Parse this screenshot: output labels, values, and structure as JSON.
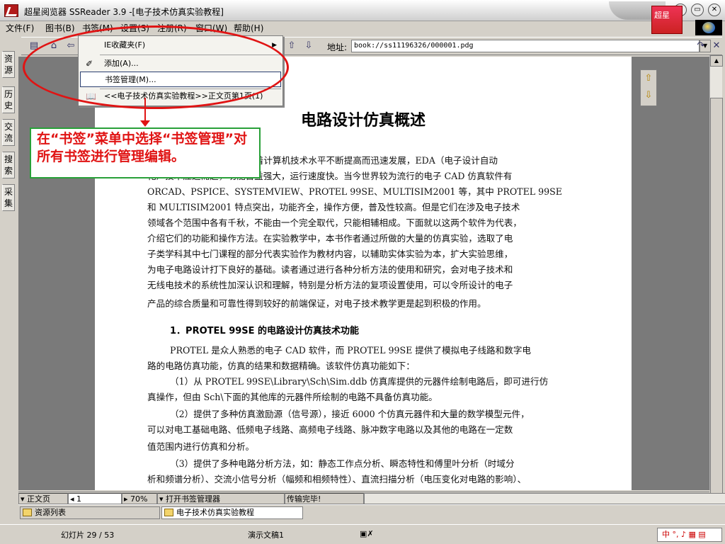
{
  "window": {
    "title": "超星阅览器 SSReader 3.9 -[电子技术仿真实验教程]",
    "brand_label": "超星"
  },
  "menubar": {
    "items": [
      "文件(F)",
      "图书(B)",
      "书签(M)",
      "设置(S)",
      "注册(R)",
      "窗口(W)",
      "帮助(H)"
    ]
  },
  "toolbar": {
    "address_label": "地址:",
    "address_value": "book://ss11196326/000001.pdg"
  },
  "left_tabs": [
    "资源",
    "历史",
    "交流",
    "搜索",
    "采集"
  ],
  "bookmark_menu": {
    "items": [
      {
        "label": "IE收藏夹(F)",
        "has_submenu": true
      },
      {
        "label": "添加(A)..."
      },
      {
        "label": "书签管理(M)...",
        "highlighted": true
      },
      {
        "label": "<<电子技术仿真实验教程>>正文页第1页(1)"
      }
    ]
  },
  "annotation": {
    "text": "在“书签”菜单中选择“书签管理”对所有书签进行管理编辑。"
  },
  "document": {
    "title": "电路设计仿真概述",
    "para1_lines": [
      "软件随着计算机技术水平不断提高而迅速发展，EDA（电子设计自动",
      "化）技术应运而起，功能日益强大，运行速度快。当今世界较为流行的电子 CAD 仿真软件有",
      "ORCAD、PSPICE、SYSTEMVIEW、PROTEL 99SE、MULTISIM2001 等，其中 PROTEL 99SE",
      "和 MULTISIM2001 特点突出，功能齐全，操作方便，普及性较高。但是它们在涉及电子技术",
      "领域各个范围中各有千秋，不能由一个完全取代，只能相辅相成。下面就以这两个软件为代表，",
      "介绍它们的功能和操作方法。在实验教学中，本书作者通过所做的大量的仿真实验，选取了电",
      "子类学科其中七门课程的部分代表实验作为教材内容，以辅助实体实验为本，扩大实验思维，",
      "为电子电路设计打下良好的基础。读者通过进行各种分析方法的使用和研究，会对电子技术和",
      "无线电技术的系统性加深认识和理解，特别是分析方法的复项设置使用，可以令所设计的电子",
      "产品的综合质量和可靠性得到较好的前端保证，对电子技术教学更是起到积极的作用。"
    ],
    "section_heading": "1．PROTEL 99SE 的电路设计仿真技术功能",
    "para2_lines": [
      "PROTEL 是众人熟悉的电子 CAD 软件，而 PROTEL 99SE 提供了模拟电子线路和数字电",
      "路的电路仿真功能，仿真的结果和数据精确。该软件仿真功能如下：",
      "（1）从 PROTEL 99SE\\Library\\Sch\\Sim.ddb 仿真库提供的元器件绘制电路后，即可进行仿",
      "真操作，但由 Sch\\下面的其他库的元器件所绘制的电路不具备仿真功能。",
      "（2）提供了多种仿真激励源（信号源），接近 6000 个仿真元器件和大量的数学模型元件，",
      "可以对电工基础电路、低频电子线路、高频电子线路、脉冲数字电路以及其他的电路在一定数",
      "值范围内进行仿真和分析。",
      "（3）提供了多种电路分析方法，如：静态工作点分析、瞬态特性和傅里叶分析（时域分",
      "析和频谱分析）、交流小信号分析（幅频和相频特性）、直流扫描分析（电压变化对电路的影响）、"
    ]
  },
  "statusbar": {
    "page_type": "正文页",
    "page_number": "1",
    "zoom": "70%",
    "message": "打开书签管理器",
    "progress": "传输完毕!"
  },
  "resource_bar": {
    "tab1": "资源列表",
    "tab2": "电子技术仿真实验教程"
  },
  "ppt_status": {
    "slide": "幻灯片 29 / 53",
    "template": "演示文稿1",
    "lang": "中"
  }
}
